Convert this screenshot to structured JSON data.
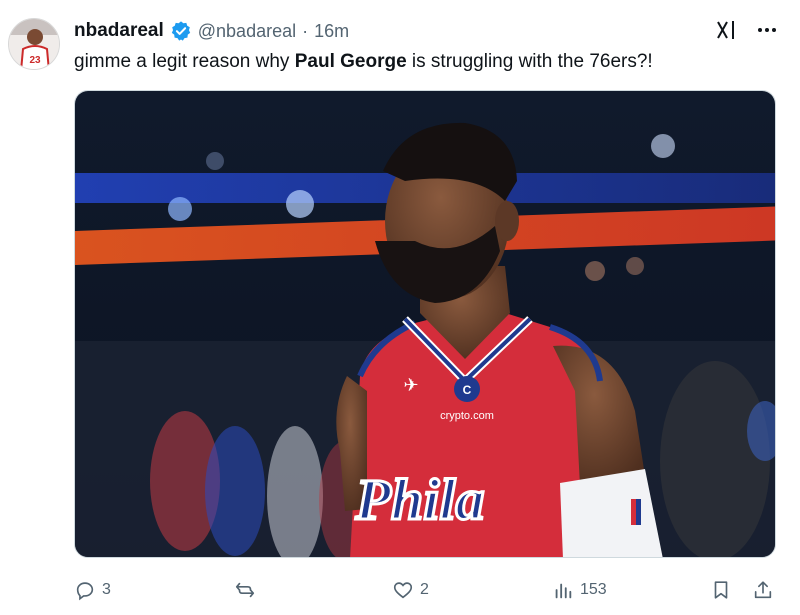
{
  "post": {
    "display_name": "nbadareal",
    "handle": "@nbadareal",
    "separator": "·",
    "time": "16m",
    "text_before": "gimme a legit reason why ",
    "text_bold": "Paul George",
    "text_after": " is struggling with the 76ers?!"
  },
  "media": {
    "jersey_text": "Phila",
    "sponsor_text": "crypto.com"
  },
  "actions": {
    "replies": "3",
    "reposts": "",
    "likes": "2",
    "views": "153"
  },
  "colors": {
    "verified": "#1d9bf0",
    "secondary_text": "#536471",
    "jersey_red": "#d42d3b",
    "jersey_blue": "#1f3a8f"
  }
}
